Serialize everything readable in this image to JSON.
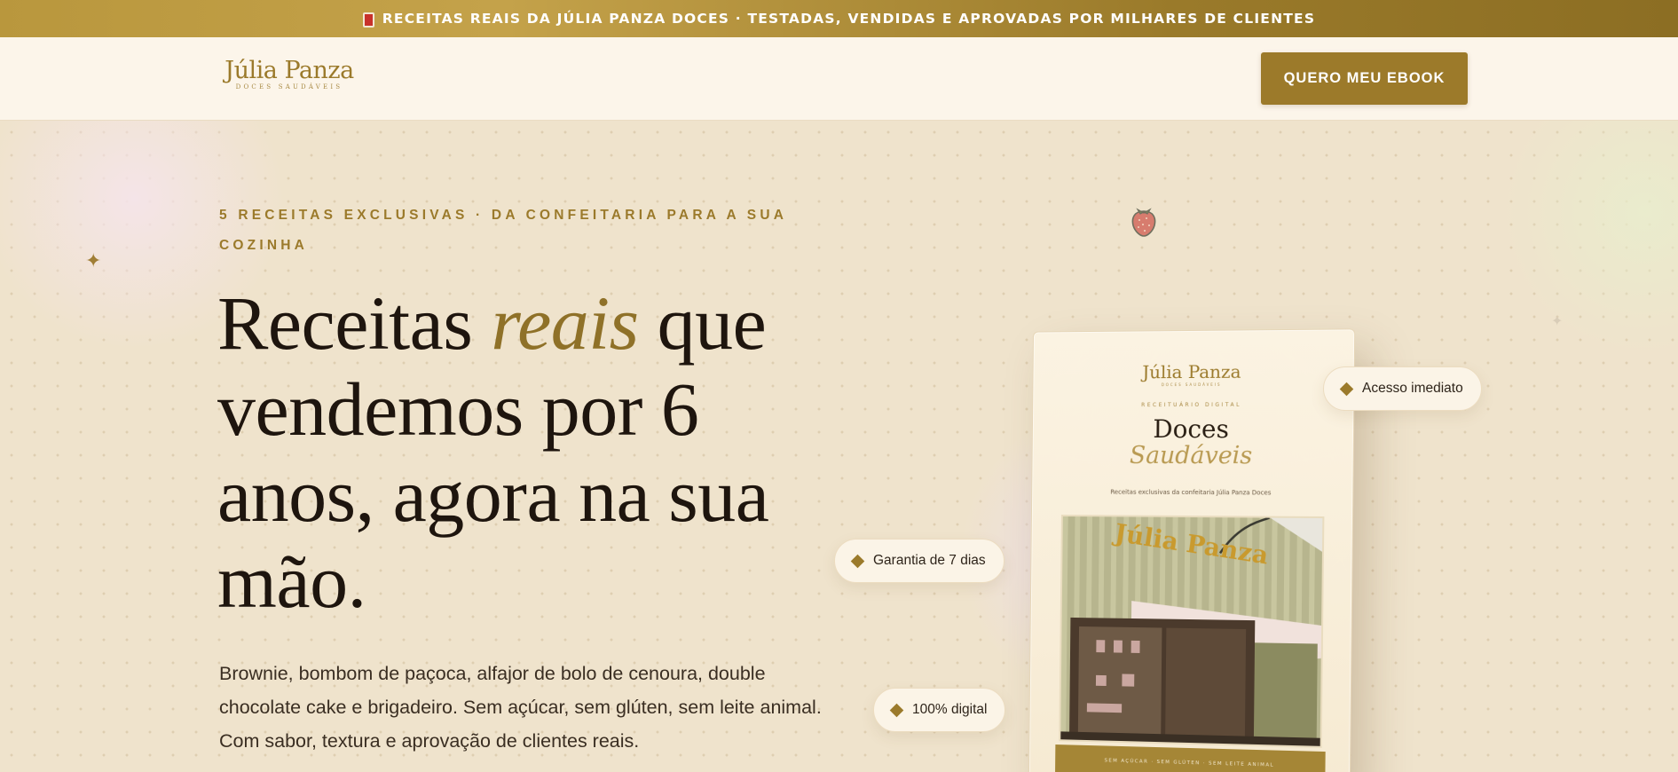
{
  "announcement": {
    "text": "RECEITAS REAIS DA JÚLIA PANZA DOCES · TESTADAS, VENDIDAS E APROVADAS POR MILHARES DE CLIENTES",
    "icon": "book-icon"
  },
  "header": {
    "logo_name": "Júlia Panza",
    "logo_sub": "DOCES SAUDÁVEIS",
    "cta_label": "QUERO MEU EBOOK"
  },
  "hero": {
    "eyebrow": "5 RECEITAS EXCLUSIVAS · DA CONFEITARIA PARA A SUA COZINHA",
    "headline_pre": "Receitas ",
    "headline_accent": "reais",
    "headline_post": " que vendemos por 6 anos, agora na sua mão.",
    "subtext": "Brownie, bombom de paçoca, alfajor de bolo de cenoura, double chocolate cake e brigadeiro. Sem açúcar, sem glúten, sem leite animal. Com sabor, textura e aprovação de clientes reais."
  },
  "ebook": {
    "logo": "Júlia Panza",
    "logo_sub": "DOCES SAUDÁVEIS",
    "kicker": "RECEITUÁRIO DIGITAL",
    "title_line1": "Doces",
    "title_line2": "Saudáveis",
    "description": "Receitas exclusivas da confeitaria Júlia Panza Doces",
    "storefront_sign": "Júlia Panza",
    "footer": "SEM AÇÚCAR · SEM GLÚTEN · SEM LEITE ANIMAL"
  },
  "badges": {
    "access": "Acesso imediato",
    "guarantee": "Garantia de 7 dias",
    "digital": "100% digital"
  },
  "colors": {
    "gold": "#9c7a2a",
    "cream": "#fcf5ea",
    "background": "#efe3cc",
    "text_dark": "#1e150e"
  }
}
